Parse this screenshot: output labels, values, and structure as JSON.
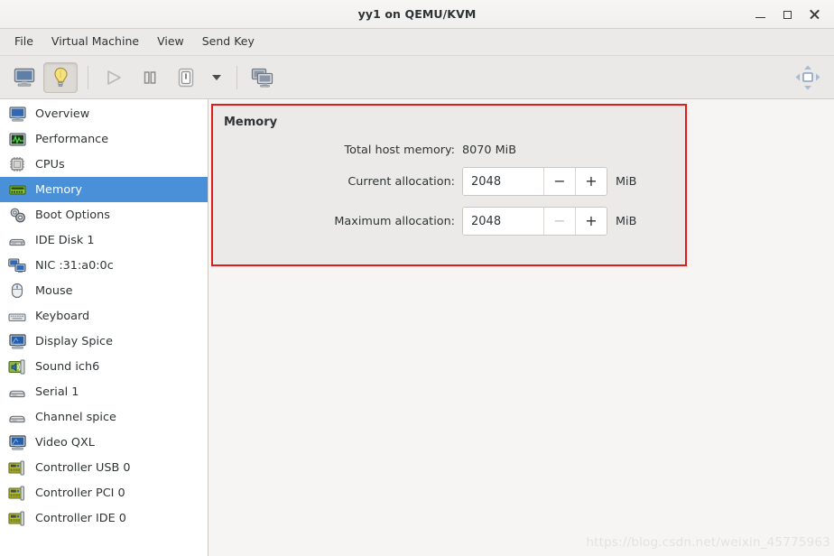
{
  "window": {
    "title": "yy1 on QEMU/KVM",
    "controls": [
      {
        "name": "minimize",
        "glyph": "minimize-icon"
      },
      {
        "name": "maximize",
        "glyph": "maximize-icon"
      },
      {
        "name": "close",
        "glyph": "close-icon"
      }
    ]
  },
  "menubar": {
    "items": [
      "File",
      "Virtual Machine",
      "View",
      "Send Key"
    ]
  },
  "toolbar": {
    "buttons": [
      {
        "name": "show-console-button",
        "icon": "monitor-icon",
        "state": "normal"
      },
      {
        "name": "show-details-button",
        "icon": "lightbulb-icon",
        "state": "pressed"
      },
      {
        "name": "run-button",
        "icon": "play-icon",
        "state": "disabled"
      },
      {
        "name": "pause-button",
        "icon": "pause-icon",
        "state": "normal"
      },
      {
        "name": "shutdown-button",
        "icon": "power-icon",
        "state": "normal"
      },
      {
        "name": "shutdown-menu-button",
        "icon": "chevron-down-icon",
        "state": "normal"
      },
      {
        "name": "snapshots-button",
        "icon": "snapshots-icon",
        "state": "normal"
      }
    ],
    "fullscreen": {
      "name": "fullscreen-button",
      "icon": "resize-vm-icon"
    }
  },
  "sidebar": {
    "selected_index": 3,
    "items": [
      {
        "label": "Overview",
        "icon": "monitor-icon"
      },
      {
        "label": "Performance",
        "icon": "graph-icon"
      },
      {
        "label": "CPUs",
        "icon": "cpu-icon"
      },
      {
        "label": "Memory",
        "icon": "memory-icon"
      },
      {
        "label": "Boot Options",
        "icon": "gears-icon"
      },
      {
        "label": "IDE Disk 1",
        "icon": "disk-icon"
      },
      {
        "label": "NIC :31:a0:0c",
        "icon": "nic-icon"
      },
      {
        "label": "Mouse",
        "icon": "mouse-icon"
      },
      {
        "label": "Keyboard",
        "icon": "keyboard-icon"
      },
      {
        "label": "Display Spice",
        "icon": "display-icon"
      },
      {
        "label": "Sound ich6",
        "icon": "sound-icon"
      },
      {
        "label": "Serial 1",
        "icon": "serial-icon"
      },
      {
        "label": "Channel spice",
        "icon": "serial-icon"
      },
      {
        "label": "Video QXL",
        "icon": "display-icon"
      },
      {
        "label": "Controller USB 0",
        "icon": "controller-icon"
      },
      {
        "label": "Controller PCI 0",
        "icon": "controller-icon"
      },
      {
        "label": "Controller IDE 0",
        "icon": "controller-icon"
      }
    ]
  },
  "memory_panel": {
    "heading": "Memory",
    "highlight_color": "#e01b1b",
    "total_host_memory": {
      "label": "Total host memory:",
      "value": "8070 MiB"
    },
    "current_allocation": {
      "label": "Current allocation:",
      "value": "2048",
      "unit": "MiB",
      "minus": "−",
      "plus": "+",
      "minus_disabled": false
    },
    "maximum_allocation": {
      "label": "Maximum allocation:",
      "value": "2048",
      "unit": "MiB",
      "minus": "−",
      "plus": "+",
      "minus_disabled": true
    }
  },
  "watermark": "https://blog.csdn.net/weixin_45775963"
}
